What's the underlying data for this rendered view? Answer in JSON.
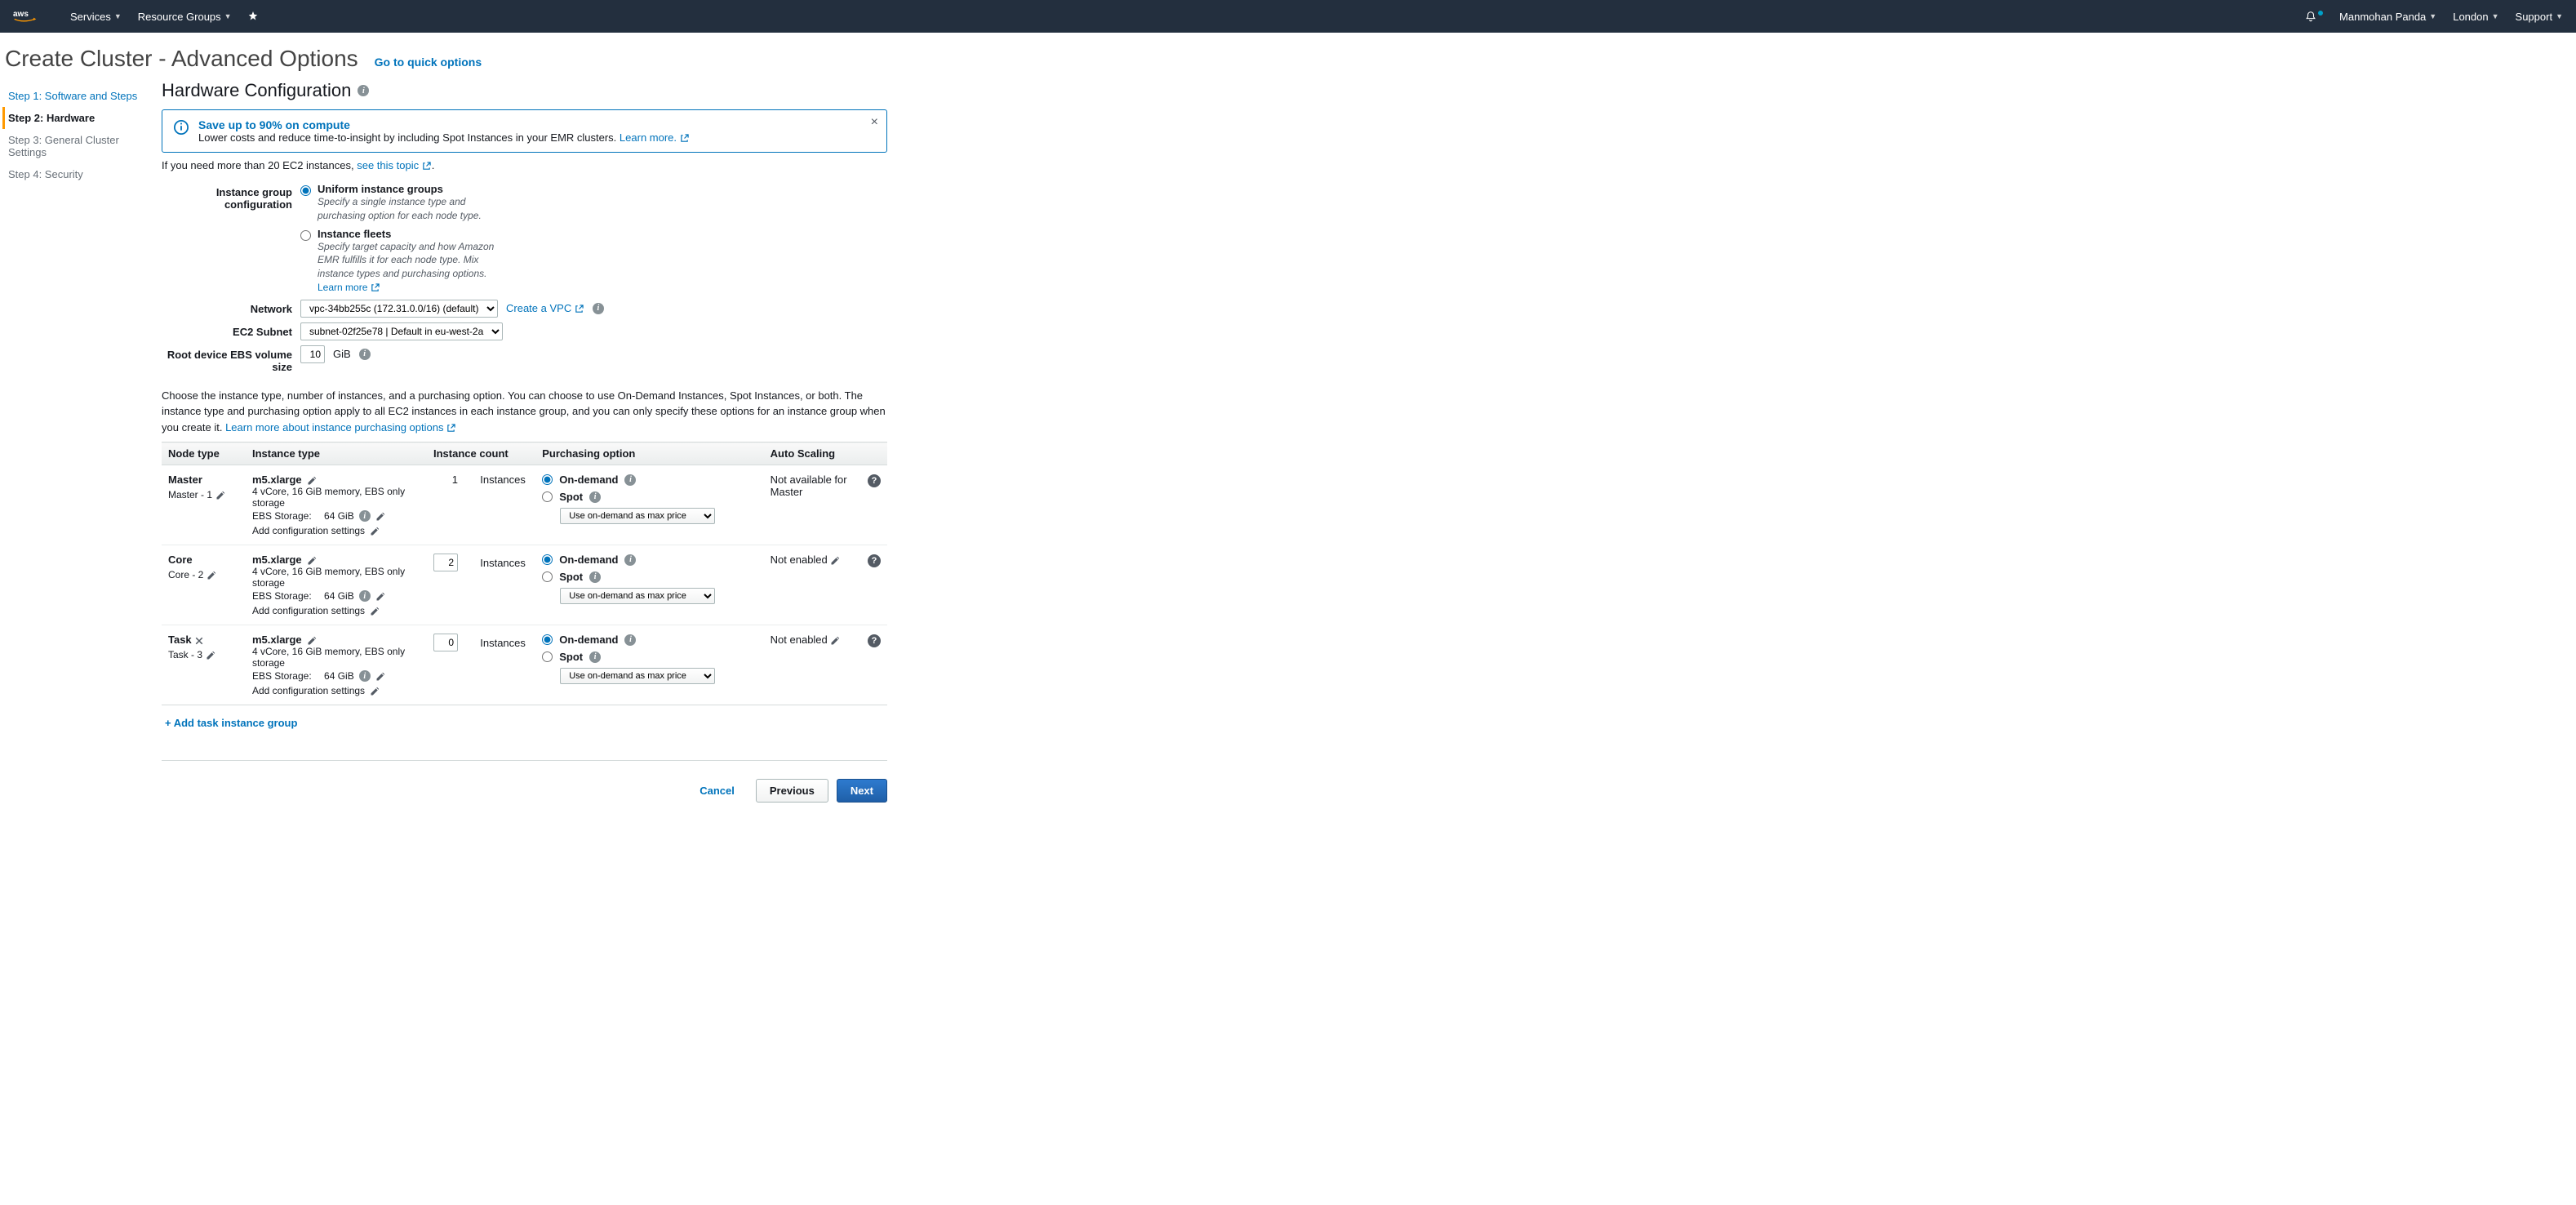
{
  "topnav": {
    "services": "Services",
    "resource_groups": "Resource Groups",
    "user": "Manmohan Panda",
    "region": "London",
    "support": "Support"
  },
  "title": "Create Cluster - Advanced Options",
  "quick_options": "Go to quick options",
  "steps": {
    "s1": "Step 1: Software and Steps",
    "s2": "Step 2: Hardware",
    "s3": "Step 3: General Cluster Settings",
    "s4": "Step 4: Security"
  },
  "section_title": "Hardware Configuration",
  "infobox": {
    "title": "Save up to 90% on compute",
    "body": "Lower costs and reduce time-to-insight by including Spot Instances in your EMR clusters.",
    "learn_more": "Learn more."
  },
  "ec2_note_pre": "If you need more than 20 EC2 instances,",
  "ec2_note_link": "see this topic",
  "form": {
    "igc_label": "Instance group configuration",
    "uniform_title": "Uniform instance groups",
    "uniform_desc": "Specify a single instance type and purchasing option for each node type.",
    "fleets_title": "Instance fleets",
    "fleets_desc": "Specify target capacity and how Amazon EMR fulfills it for each node type. Mix instance types and purchasing options.",
    "fleets_learn": "Learn more",
    "network_label": "Network",
    "network_value": "vpc-34bb255c (172.31.0.0/16) (default)",
    "create_vpc": "Create a VPC",
    "subnet_label": "EC2 Subnet",
    "subnet_value": "subnet-02f25e78 | Default in eu-west-2a",
    "root_label": "Root device EBS volume size",
    "root_value": "10",
    "gib": "GiB"
  },
  "desc": {
    "text": "Choose the instance type, number of instances, and a purchasing option. You can choose to use On-Demand Instances, Spot Instances, or both. The instance type and purchasing option apply to all EC2 instances in each instance group, and you can only specify these options for an instance group when you create it.",
    "learn": "Learn more about instance purchasing options"
  },
  "table": {
    "headers": {
      "node": "Node type",
      "instance": "Instance type",
      "count": "Instance count",
      "purchase": "Purchasing option",
      "scaling": "Auto Scaling"
    },
    "shared": {
      "it_desc": "4 vCore, 16 GiB memory, EBS only storage",
      "ebs_label": "EBS Storage:",
      "ebs_val": "64 GiB",
      "add_config": "Add configuration settings",
      "instances": "Instances",
      "on_demand": "On-demand",
      "spot": "Spot",
      "spot_option": "Use on-demand as max price"
    },
    "rows": [
      {
        "node_name": "Master",
        "node_sub": "Master - 1",
        "removable": false,
        "it_name": "m5.xlarge",
        "count": "1",
        "count_readonly": true,
        "scaling": "Not available for Master",
        "scaling_edit": false
      },
      {
        "node_name": "Core",
        "node_sub": "Core - 2",
        "removable": false,
        "it_name": "m5.xlarge",
        "count": "2",
        "count_readonly": false,
        "scaling": "Not enabled",
        "scaling_edit": true
      },
      {
        "node_name": "Task",
        "node_sub": "Task - 3",
        "removable": true,
        "it_name": "m5.xlarge",
        "count": "0",
        "count_readonly": false,
        "scaling": "Not enabled",
        "scaling_edit": true
      }
    ]
  },
  "add_task": "+ Add task instance group",
  "buttons": {
    "cancel": "Cancel",
    "previous": "Previous",
    "next": "Next"
  }
}
